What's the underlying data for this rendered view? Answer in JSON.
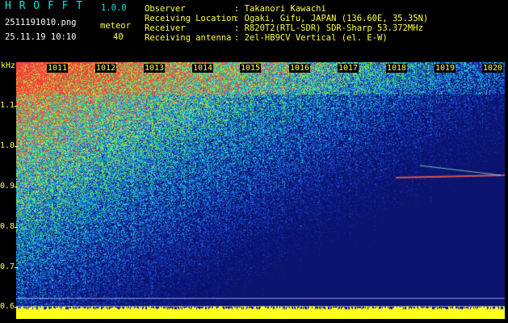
{
  "app": {
    "title": "H R O F F T",
    "version": "1.0.0"
  },
  "file": {
    "name": "2511191010.png",
    "datetime": "25.11.19 10:10"
  },
  "detection": {
    "label": "meteor",
    "count": "40"
  },
  "info": {
    "rows": [
      {
        "key": "Observer",
        "value": ": Takanori Kawachi"
      },
      {
        "key": "Receiving Location",
        "value": ": Ogaki, Gifu, JAPAN (136.60E, 35.35N)"
      },
      {
        "key": "Receiver",
        "value": ": R820T2(RTL-SDR) SDR-Sharp 53.372MHz"
      },
      {
        "key": "Receiving antenna",
        "value": ": 2el-HB9CV Vertical (el. E-W)"
      }
    ]
  },
  "y_axis": {
    "unit": "kHz",
    "ticks": [
      "1.1",
      "1.0",
      "0.9",
      "0.8",
      "0.7",
      "0.6"
    ]
  },
  "x_axis": {
    "ticks": [
      "1011",
      "1012",
      "1013",
      "1014",
      "1015",
      "1016",
      "1017",
      "1018",
      "1019",
      "1020"
    ]
  },
  "colors": {
    "label_cyan": "#00e5e5",
    "label_yellow": "#ffff40",
    "background": "#000000"
  }
}
